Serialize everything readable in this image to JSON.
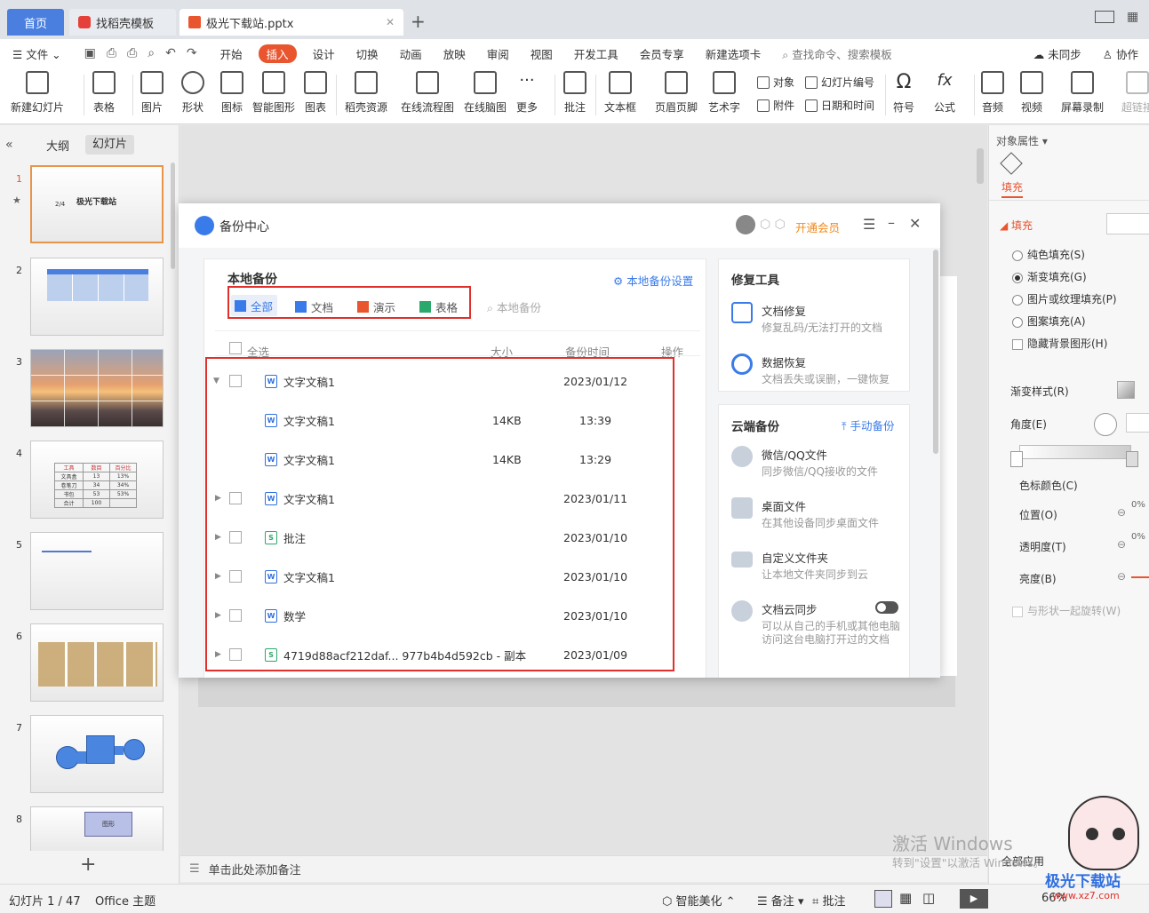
{
  "tabs": {
    "home": "首页",
    "template": "找稻壳模板",
    "document": "极光下载站.pptx",
    "add": "+"
  },
  "menu": {
    "file": "文件",
    "items": [
      "开始",
      "插入",
      "设计",
      "切换",
      "动画",
      "放映",
      "审阅",
      "视图",
      "开发工具",
      "会员专享",
      "新建选项卡"
    ],
    "active": "插入",
    "search": "查找命令、搜索模板",
    "sync": "未同步",
    "collab": "协作"
  },
  "ribbon": {
    "new_slide": "新建幻灯片",
    "table": "表格",
    "picture": "图片",
    "shape": "形状",
    "icon": "图标",
    "smart": "智能图形",
    "chart": "图表",
    "daoke": "稻壳资源",
    "flowchart": "在线流程图",
    "mindmap": "在线脑图",
    "more": "更多",
    "comment": "批注",
    "textbox": "文本框",
    "header": "页眉页脚",
    "wordart": "艺术字",
    "object": "对象",
    "slide_no": "幻灯片编号",
    "attach": "附件",
    "datetime": "日期和时间",
    "symbol": "符号",
    "formula": "公式",
    "audio": "音频",
    "video": "视频",
    "screenrec": "屏幕录制",
    "hyperlink": "超链接"
  },
  "left_panel": {
    "outline_tab": "大纲",
    "slides_tab": "幻灯片",
    "slide_numbers": [
      "1",
      "2",
      "3",
      "4",
      "5",
      "6",
      "7",
      "8"
    ],
    "slide1_title": "极光下载站",
    "slide1_fraction": "2/4",
    "slide4_table": [
      [
        "工具",
        "数目",
        "百分比"
      ],
      [
        "文具盒",
        "13",
        "13%"
      ],
      [
        "卷笔刀",
        "34",
        "34%"
      ],
      [
        "书包",
        "53",
        "53%"
      ],
      [
        "合计",
        "100",
        ""
      ]
    ],
    "slide8_label": "图形"
  },
  "notes_placeholder": "单击此处添加备注",
  "dialog": {
    "title": "备份中心",
    "vip": "开通会员",
    "local_backup": "本地备份",
    "local_settings": "本地备份设置",
    "filters": [
      "全部",
      "文档",
      "演示",
      "表格"
    ],
    "search_placeholder": "本地备份",
    "col_selectall": "全选",
    "col_size": "大小",
    "col_time": "备份时间",
    "col_action": "操作",
    "rows": [
      {
        "name": "文字文稿1",
        "size": "",
        "time": "2023/01/12",
        "type": "W"
      },
      {
        "name": "文字文稿1",
        "size": "14KB",
        "time": "13:39",
        "type": "W"
      },
      {
        "name": "文字文稿1",
        "size": "14KB",
        "time": "13:29",
        "type": "W"
      },
      {
        "name": "文字文稿1",
        "size": "",
        "time": "2023/01/11",
        "type": "W"
      },
      {
        "name": "批注",
        "size": "",
        "time": "2023/01/10",
        "type": "S"
      },
      {
        "name": "文字文稿1",
        "size": "",
        "time": "2023/01/10",
        "type": "W"
      },
      {
        "name": "数学",
        "size": "",
        "time": "2023/01/10",
        "type": "W"
      },
      {
        "name": "4719d88acf212daf... 977b4b4d592cb - 副本",
        "size": "",
        "time": "2023/01/09",
        "type": "S"
      }
    ],
    "repair_title": "修复工具",
    "repair": [
      {
        "t": "文档修复",
        "d": "修复乱码/无法打开的文档"
      },
      {
        "t": "数据恢复",
        "d": "文档丢失或误删，一键恢复"
      }
    ],
    "cloud_title": "云端备份",
    "cloud_manual": "手动备份",
    "cloud": [
      {
        "t": "微信/QQ文件",
        "d": "同步微信/QQ接收的文件"
      },
      {
        "t": "桌面文件",
        "d": "在其他设备同步桌面文件"
      },
      {
        "t": "自定义文件夹",
        "d": "让本地文件夹同步到云"
      },
      {
        "t": "文档云同步",
        "d": "可以从自己的手机或其他电脑访问这台电脑打开过的文档"
      }
    ]
  },
  "right_panel": {
    "header": "对象属性",
    "fill_tab": "填充",
    "fill_section": "填充",
    "options": [
      "纯色填充(S)",
      "渐变填充(G)",
      "图片或纹理填充(P)",
      "图案填充(A)"
    ],
    "hide_bg": "隐藏背景图形(H)",
    "gradient_style": "渐变样式(R)",
    "angle": "角度(E)",
    "stop_color": "色标颜色(C)",
    "position": "位置(O)",
    "transparency": "透明度(T)",
    "brightness": "亮度(B)",
    "pct": "0%",
    "rotate": "与形状一起旋转(W)",
    "apply_all": "全部应用"
  },
  "status": {
    "slide": "幻灯片 1 / 47",
    "theme": "Office 主题",
    "beautify": "智能美化",
    "notes": "备注",
    "comment": "批注",
    "zoom": "66%"
  },
  "watermark": {
    "line1": "激活 Windows",
    "line2": "转到\"设置\"以激活 Windows。",
    "logo": "极光下载站",
    "url": "www.xz7.com"
  },
  "colors": {
    "accent": "#4a7fe0",
    "insert_tab": "#e8552f",
    "highlight": "#e0302b",
    "vip": "#f08a1c"
  }
}
